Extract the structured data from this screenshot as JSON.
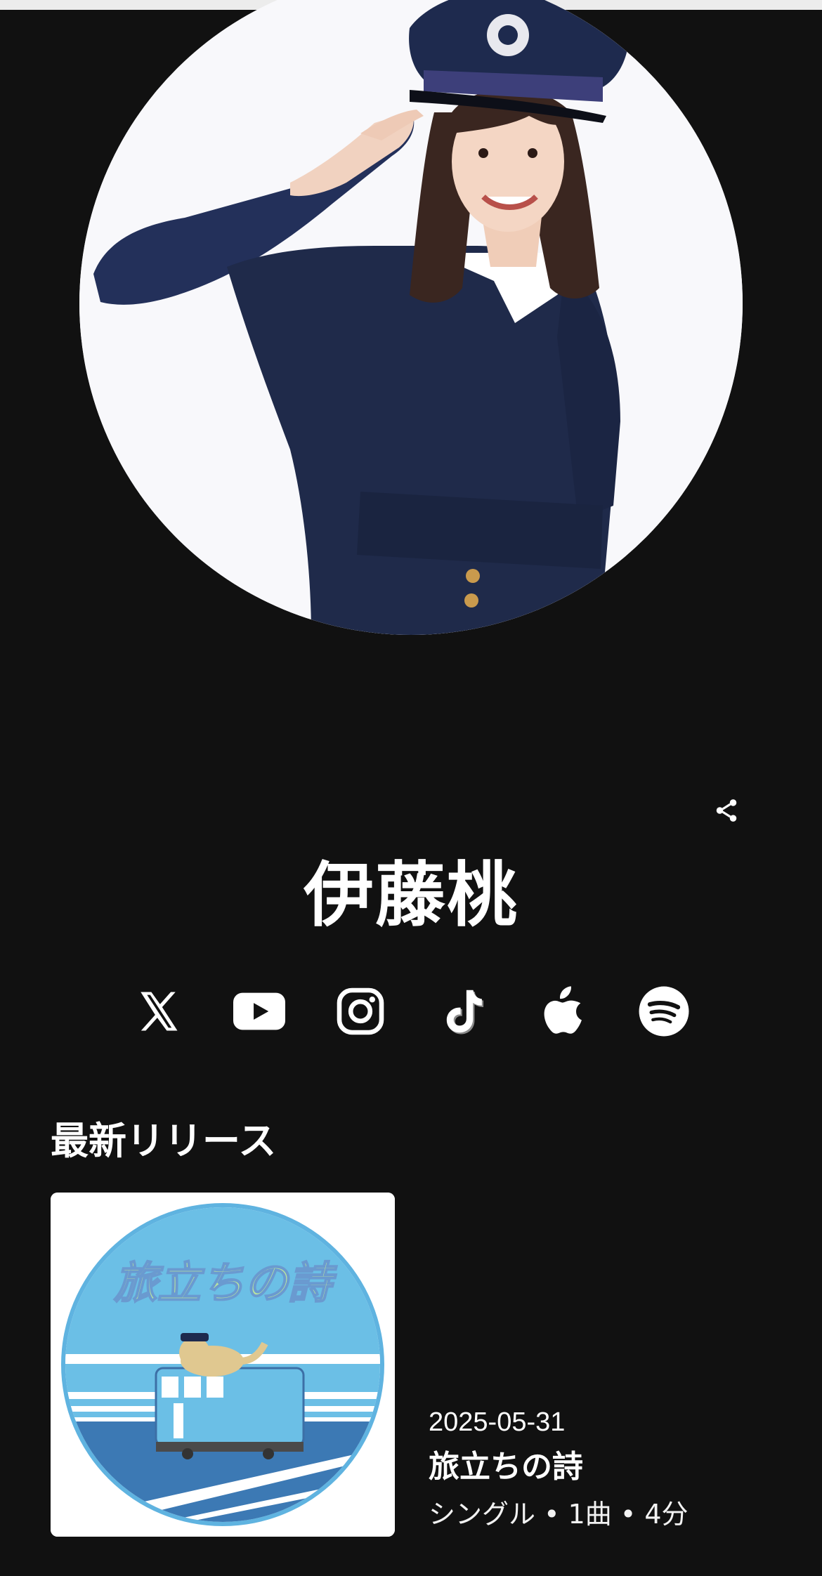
{
  "artist": {
    "name": "伊藤桃"
  },
  "actions": {
    "share_icon": "share-icon"
  },
  "socials": [
    {
      "name": "X",
      "icon": "x-icon"
    },
    {
      "name": "YouTube",
      "icon": "youtube-icon"
    },
    {
      "name": "Instagram",
      "icon": "instagram-icon"
    },
    {
      "name": "TikTok",
      "icon": "tiktok-icon"
    },
    {
      "name": "Apple Music",
      "icon": "apple-icon"
    },
    {
      "name": "Spotify",
      "icon": "spotify-icon"
    }
  ],
  "latest_release": {
    "section_title": "最新リリース",
    "date": "2025-05-31",
    "title": "旅立ちの詩",
    "meta": "シングル • 1曲 • 4分",
    "cover_text": "旅立ちの詩"
  },
  "colors": {
    "background": "#111111",
    "text": "#ffffff",
    "cover_sky": "#6bbfe6",
    "cover_ring": "#5fb3e0",
    "uniform_navy": "#1f2a4a"
  }
}
